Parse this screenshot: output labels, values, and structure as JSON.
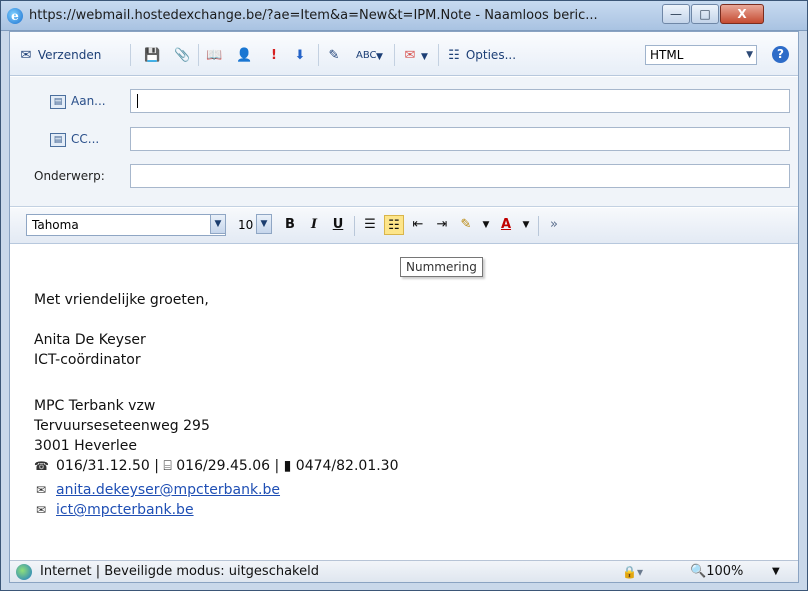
{
  "window": {
    "title": "https://webmail.hostedexchange.be/?ae=Item&a=New&t=IPM.Note - Naamloos beric...",
    "minimize": "—",
    "maximize": "□",
    "close": "X"
  },
  "toolbar": {
    "send_label": "Verzenden",
    "options_label": "Opties...",
    "format_value": "HTML"
  },
  "header": {
    "to_label": "Aan...",
    "cc_label": "CC...",
    "subject_label": "Onderwerp:",
    "to_value": "",
    "cc_value": "",
    "subject_value": ""
  },
  "format_bar": {
    "font": "Tahoma",
    "size": "10",
    "bold": "B",
    "italic": "I",
    "underline": "U"
  },
  "tooltip": "Nummering",
  "body": {
    "greeting": "Met vriendelijke groeten,",
    "name": "Anita De Keyser",
    "role": "ICT-coördinator",
    "org": "MPC Terbank vzw",
    "street": "Tervuurseseteenweg 295",
    "city": "3001 Heverlee",
    "phones": "016/31.12.50 | ⌸ 016/29.45.06 | ▮ 0474/82.01.30",
    "email1": "anita.dekeyser@mpcterbank.be",
    "email2": "ict@mpcterbank.be"
  },
  "status": {
    "text": "Internet | Beveiligde modus: uitgeschakeld",
    "zoom": "100%"
  }
}
